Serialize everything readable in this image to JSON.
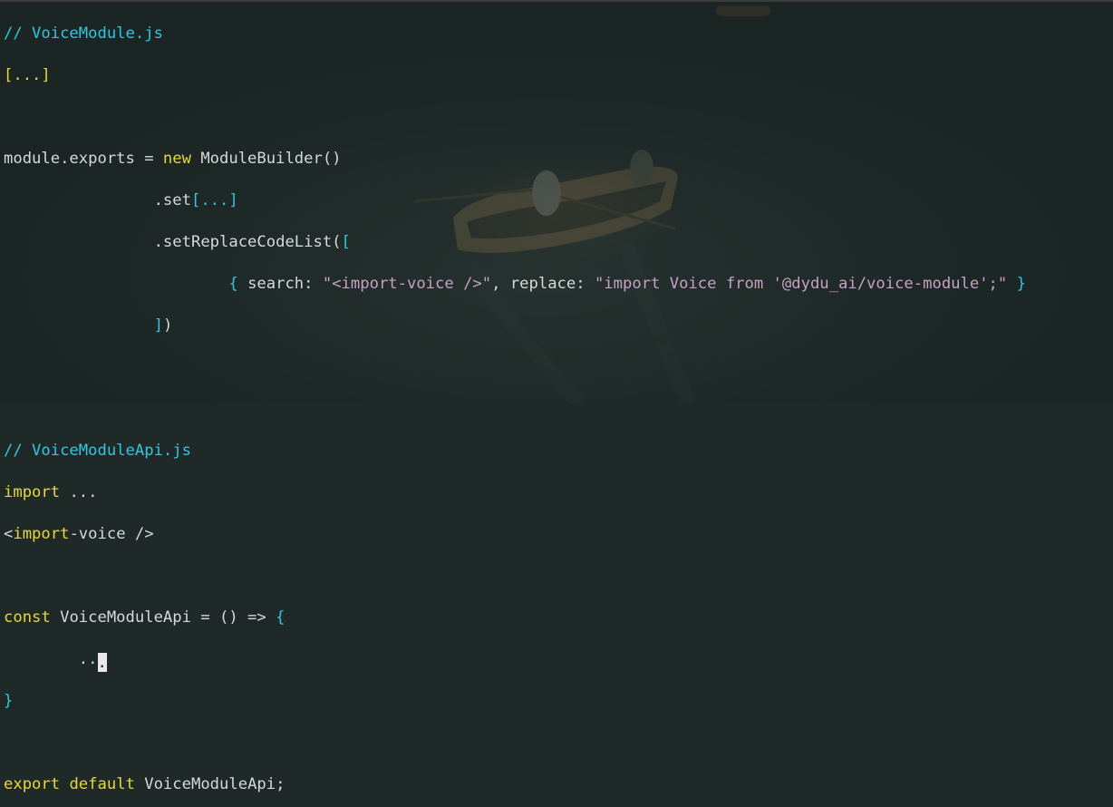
{
  "code": {
    "l1_comment": "// VoiceModule.js",
    "l2_ellipsis": "[...]",
    "l4_plain": "module.exports = ",
    "l4_new": "new",
    "l4_rest": " ModuleBuilder()",
    "l5_set": ".set",
    "l5_ellipsis": "[...]",
    "l6_method": ".setReplaceCodeList(",
    "l6_bracket": "[",
    "l7_brace_open": "{",
    "l7_search_key": " search: ",
    "l7_search_val": "\"<import-voice />\"",
    "l7_sep": ", replace: ",
    "l7_replace_val": "\"import Voice from '@dydu_ai/voice-module';\"",
    "l7_brace_close": " }",
    "l8_close_bracket": "]",
    "l8_close_paren": ")",
    "l11_comment": "// VoiceModuleApi.js",
    "l12_import": "import",
    "l12_rest": " ...",
    "l13_lt": "<",
    "l13_import": "import",
    "l13_rest": "-voice />",
    "l15_const": "const",
    "l15_rest": " VoiceModuleApi = () => ",
    "l15_brace": "{",
    "l16_dots": "..",
    "l16_cursor": ".",
    "l17_brace": "}",
    "l19_export": "export",
    "l19_default": "default",
    "l19_rest": " VoiceModuleApi;"
  }
}
